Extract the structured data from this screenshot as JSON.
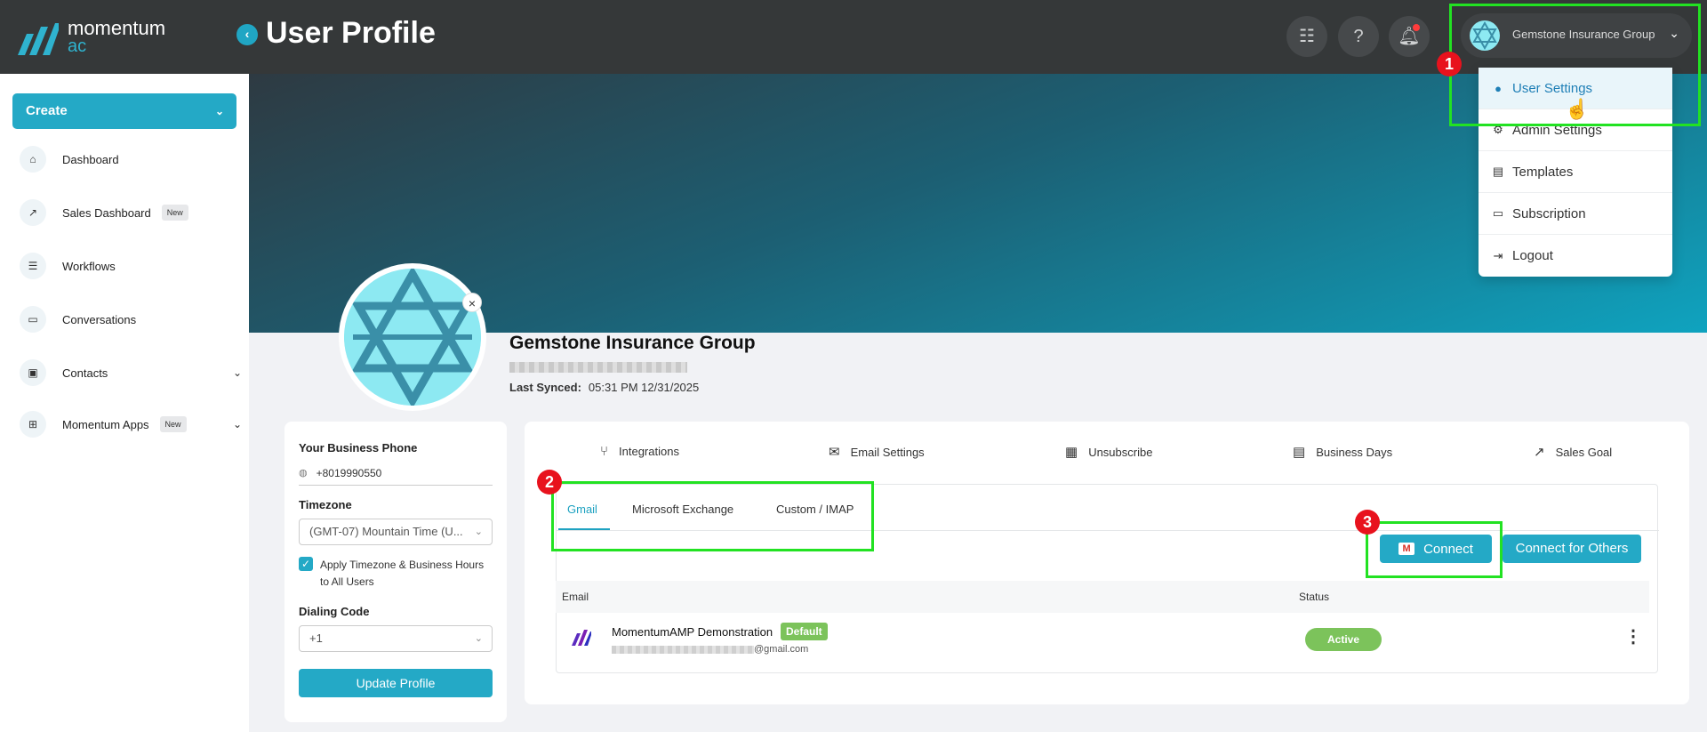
{
  "header": {
    "brand_line1": "momentum",
    "brand_line2": "ac",
    "collapse_icon": "‹",
    "page_title": "User Profile",
    "user_name": "Gemstone Insurance Group"
  },
  "sidebar": {
    "create_label": "Create",
    "items": [
      {
        "label": "Dashboard",
        "icon": "home-icon",
        "glyph": "⌂"
      },
      {
        "label": "Sales Dashboard",
        "icon": "chart-icon",
        "glyph": "↗",
        "badge": "New"
      },
      {
        "label": "Workflows",
        "icon": "workflow-icon",
        "glyph": "☰"
      },
      {
        "label": "Conversations",
        "icon": "chat-icon",
        "glyph": "▭"
      },
      {
        "label": "Contacts",
        "icon": "contacts-icon",
        "glyph": "▣"
      },
      {
        "label": "Momentum Apps",
        "icon": "apps-icon",
        "glyph": "⊞",
        "badge": "New"
      }
    ]
  },
  "profile": {
    "org_name": "Gemstone Insurance Group",
    "last_synced_label": "Last Synced:",
    "last_synced_value": "05:31 PM 12/31/2025"
  },
  "settings_form": {
    "phone_label": "Your Business Phone",
    "phone_value": "+8019990550",
    "timezone_label": "Timezone",
    "timezone_value": "(GMT-07) Mountain Time (U...",
    "apply_checkbox_label": "Apply Timezone & Business Hours to All Users",
    "dialing_label": "Dialing Code",
    "dialing_value": "+1",
    "update_button": "Update Profile"
  },
  "top_tabs": [
    {
      "label": "Integrations",
      "glyph": "⑂"
    },
    {
      "label": "Email Settings",
      "glyph": "✉"
    },
    {
      "label": "Unsubscribe",
      "glyph": "▦"
    },
    {
      "label": "Business Days",
      "glyph": "▤"
    },
    {
      "label": "Sales Goal",
      "glyph": "↗"
    }
  ],
  "email_tabs": [
    "Gmail",
    "Microsoft Exchange",
    "Custom / IMAP"
  ],
  "buttons": {
    "connect": "Connect",
    "connect_others": "Connect for Others"
  },
  "table": {
    "columns": [
      "Email",
      "Status"
    ],
    "rows": [
      {
        "name": "MomentumAMP Demonstration",
        "badge": "Default",
        "email_suffix": "@gmail.com",
        "status": "Active"
      }
    ]
  },
  "dropdown": {
    "items": [
      {
        "label": "User Settings",
        "icon": "user-icon",
        "glyph": "●"
      },
      {
        "label": "Admin Settings",
        "icon": "gear-icon",
        "glyph": "⚙"
      },
      {
        "label": "Templates",
        "icon": "template-icon",
        "glyph": "▤"
      },
      {
        "label": "Subscription",
        "icon": "card-icon",
        "glyph": "▭"
      },
      {
        "label": "Logout",
        "icon": "logout-icon",
        "glyph": "⇥"
      }
    ]
  },
  "annotations": [
    "1",
    "2",
    "3"
  ],
  "colors": {
    "accent": "#24a9c6",
    "topbar": "#353839",
    "highlight": "#22e222",
    "marker": "#e8121d",
    "status_green": "#7cc35b"
  }
}
